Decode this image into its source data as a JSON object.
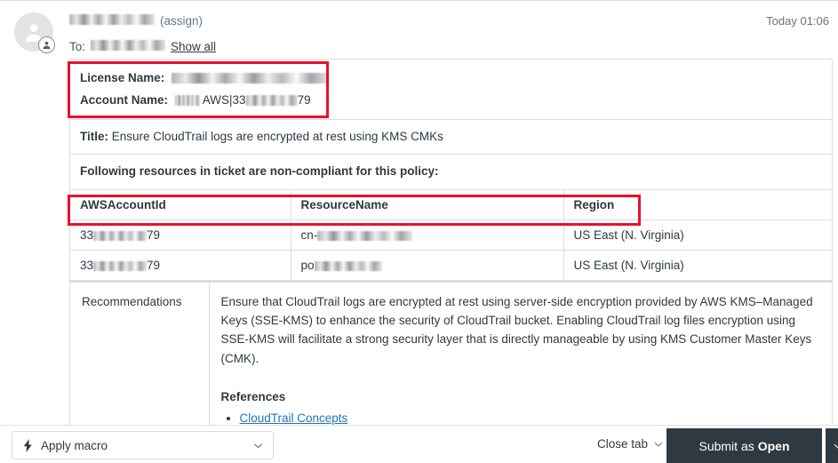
{
  "header": {
    "sender_redacted": true,
    "assign_label": "(assign)",
    "to_label": "To:",
    "show_all_label": "Show all",
    "timestamp": "Today 01:06",
    "avatar_icon": "user-avatar-icon",
    "avatar_badge_icon": "user-badge-icon"
  },
  "ticket": {
    "license_name_label": "License Name:",
    "license_name_value": "",
    "account_name_label": "Account Name:",
    "account_name_prefix": "",
    "account_name_value": "AWS|33",
    "account_name_suffix": "79",
    "title_label": "Title:",
    "title_value": "Ensure CloudTrail logs are encrypted at rest using KMS CMKs",
    "noncompliant_text": "Following resources in ticket are non-compliant for this policy:"
  },
  "resources_table": {
    "columns": [
      "AWSAccountId",
      "ResourceName",
      "Region"
    ],
    "rows": [
      {
        "account_prefix": "33",
        "account_suffix": "79",
        "resource_prefix": "cn-",
        "region": "US East (N. Virginia)"
      },
      {
        "account_prefix": "33",
        "account_suffix": "79",
        "resource_prefix": "po",
        "region": "US East (N. Virginia)"
      }
    ]
  },
  "recommendations": {
    "label": "Recommendations",
    "body": "Ensure that CloudTrail logs are encrypted at rest using server-side encryption provided by AWS KMS–Managed Keys (SSE-KMS) to enhance the security of CloudTrail bucket. Enabling CloudTrail log files encryption using SSE-KMS will facilitate a strong security layer that is directly manageable by using KMS Customer Master Keys (CMK).",
    "references_label": "References",
    "references": [
      {
        "label": "CloudTrail Concepts"
      }
    ]
  },
  "footer": {
    "macro_label": "Apply macro",
    "macro_icon": "lightning-bolt-icon",
    "macro_chevron_icon": "chevron-down-icon",
    "close_tab_label": "Close tab",
    "close_tab_chevron_icon": "chevron-down-icon",
    "submit_prefix": "Submit as",
    "submit_status": "Open",
    "submit_split_chevron_icon": "chevron-down-icon"
  },
  "annotations": {
    "license_box_color": "#e8112d",
    "table_header_box_color": "#e8112d"
  },
  "theme": {
    "link_color": "#1f73b7",
    "text_color": "#2f3941",
    "muted_text_color": "#68737d",
    "border_color": "#dcdcdc",
    "submit_button_bg": "#2f3941",
    "annotation_red": "#e8112d"
  }
}
